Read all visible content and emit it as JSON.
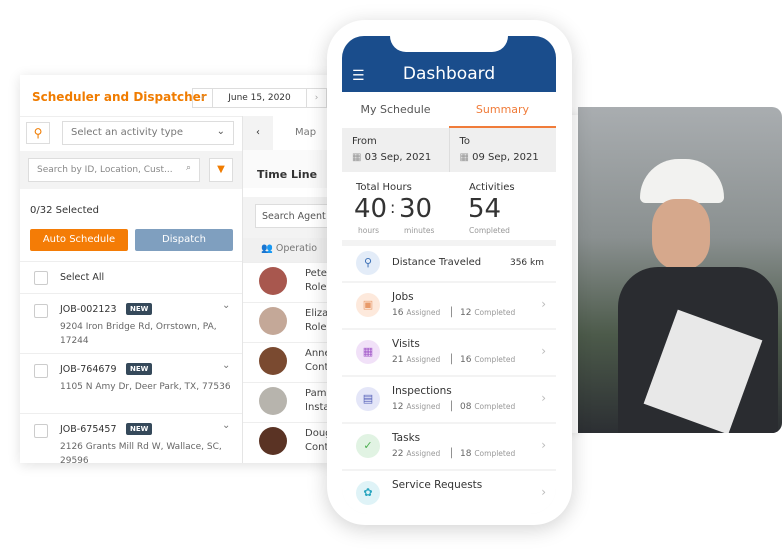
{
  "scheduler": {
    "title": "Scheduler and Dispatcher",
    "date": "June 15, 2020",
    "activity_placeholder": "Select an activity type",
    "search_placeholder": "Search by ID, Location, Cust...",
    "selected_count": "0/32 Selected",
    "auto_schedule": "Auto Schedule",
    "dispatch": "Dispatch",
    "select_all": "Select All",
    "jobs": [
      {
        "id": "JOB-002123",
        "badge": "NEW",
        "addr": "9204 Iron Bridge Rd, Orrstown, PA, 17244"
      },
      {
        "id": "JOB-764679",
        "badge": "NEW",
        "addr": "1105 N Amy Dr, Deer Park, TX, 77536"
      },
      {
        "id": "JOB-675457",
        "badge": "NEW",
        "addr": "2126 Grants Mill Rd W, Wallace, SC, 29596"
      }
    ],
    "map_tab": "Map",
    "timeline": "Time Line",
    "agent_search_placeholder": "Search Agent",
    "group": "Operatio",
    "agents": [
      {
        "name": "Peter",
        "role": "Role"
      },
      {
        "name": "Eliza",
        "role": "Role"
      },
      {
        "name": "Anne",
        "role": "Cont"
      },
      {
        "name": "Pame",
        "role": "Insta"
      },
      {
        "name": "Doug",
        "role": "Cont"
      }
    ]
  },
  "mobile": {
    "title": "Dashboard",
    "tabs": [
      "My Schedule",
      "Summary"
    ],
    "active_tab": "Summary",
    "from_label": "From",
    "from_date": "03 Sep, 2021",
    "to_label": "To",
    "to_date": "09 Sep, 2021",
    "total_hours_label": "Total Hours",
    "hours": "40",
    "hours_unit": "hours",
    "minutes": "30",
    "minutes_unit": "minutes",
    "activities_label": "Activities",
    "activities": "54",
    "activities_unit": "Completed",
    "distance_label": "Distance Traveled",
    "distance": "356 km",
    "cards": [
      {
        "name": "Jobs",
        "assigned": "16",
        "completed": "12",
        "icon": "briefcase-icon",
        "color": "#fde9dc"
      },
      {
        "name": "Visits",
        "assigned": "21",
        "completed": "16",
        "icon": "calendar-pin-icon",
        "color": "#f1e1f8"
      },
      {
        "name": "Inspections",
        "assigned": "12",
        "completed": "08",
        "icon": "inspection-icon",
        "color": "#e4e6f8"
      },
      {
        "name": "Tasks",
        "assigned": "22",
        "completed": "18",
        "icon": "clipboard-check-icon",
        "color": "#e1f3e3"
      },
      {
        "name": "Service Requests",
        "icon": "service-hand-icon",
        "color": "#dff3f7"
      }
    ],
    "assigned_label": "Assigned",
    "completed_label": "Completed"
  },
  "colors": {
    "accent": "#f47c06",
    "header": "#1a4d8c"
  }
}
